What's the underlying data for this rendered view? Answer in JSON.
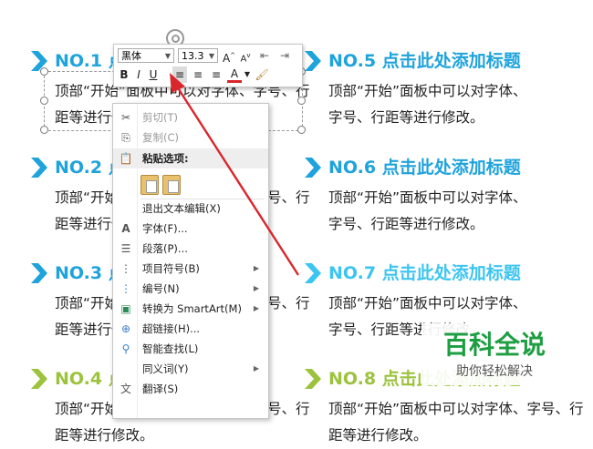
{
  "slide": {
    "items": [
      {
        "title": "NO.1 点击此处添加标题",
        "body": "顶部“开始”面板中可以对字体、字号、行距等进行修改。",
        "color": "#1fa3dc"
      },
      {
        "title": "NO.2 点击此处添加标题",
        "body": "顶部“开始”面板中可以对字体、字号、行距等进行修改。",
        "color": "#1fa3dc"
      },
      {
        "title": "NO.3 点击此处添加标题",
        "body": "顶部“开始”面板中可以对字体、字号、行距等进行修改。",
        "color": "#1fa3dc"
      },
      {
        "title": "NO.4 点击此处添加标题",
        "body": "顶部“开始”面板中可以对字体、字号、行距等进行修改。",
        "color": "#9cc33d"
      },
      {
        "title": "NO.5 点击此处添加标题",
        "body": "顶部“开始”面板中可以对字体、\n字号、行距等进行修改。",
        "color": "#1fa3dc"
      },
      {
        "title": "NO.6 点击此处添加标题",
        "body": "顶部“开始”面板中可以对字体、\n字号、行距等进行修改。",
        "color": "#1fa3dc"
      },
      {
        "title": "NO.7 点击此处添加标题",
        "body": "顶部“开始”面板中可以对字体、\n字号、行距等进行修改。",
        "color": "#3cc5f0"
      },
      {
        "title": "NO.8 点击此处添加标题",
        "body": "顶部“开始”面板中可以对字体、字号、行距等进行修改。",
        "color": "#9cc33d"
      }
    ]
  },
  "mini_toolbar": {
    "font_name": "黑体",
    "font_size": "13.3",
    "grow_font": "A",
    "shrink_font": "A",
    "bold": "B",
    "italic": "I",
    "underline": "U",
    "font_color": "A"
  },
  "context_menu": {
    "cut": "剪切(T)",
    "copy": "复制(C)",
    "paste_header": "粘贴选项:",
    "exit_edit": "退出文本编辑(X)",
    "font": "字体(F)...",
    "paragraph": "段落(P)...",
    "bullets": "项目符号(B)",
    "numbering": "编号(N)",
    "smartart": "转换为 SmartArt(M)",
    "hyperlink": "超链接(H)...",
    "smart_lookup": "智能查找(L)",
    "synonyms": "同义词(Y)",
    "translate": "翻译(S)"
  },
  "watermark": {
    "title": "百科全说",
    "subtitle": "助你轻松解决"
  },
  "colors": {
    "blue": "#1fa3dc",
    "cyan": "#3cc5f0",
    "green": "#9cc33d",
    "arrow_red": "#d9262c",
    "watermark_green": "#1e9e43"
  }
}
